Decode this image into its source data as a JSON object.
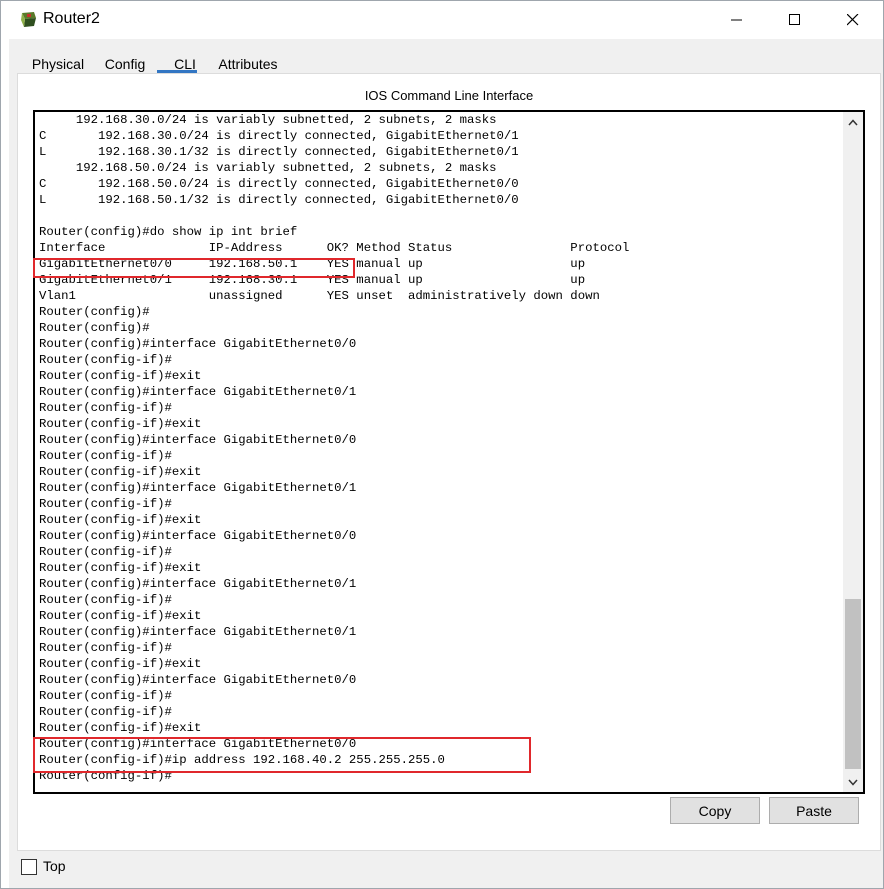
{
  "window": {
    "title": "Router2"
  },
  "tabs": [
    {
      "label": "Physical"
    },
    {
      "label": "Config"
    },
    {
      "label": "CLI"
    },
    {
      "label": "Attributes"
    }
  ],
  "active_tab": "CLI",
  "panel": {
    "title": "IOS Command Line Interface"
  },
  "console": {
    "lines": [
      "     192.168.30.0/24 is variably subnetted, 2 subnets, 2 masks",
      "C       192.168.30.0/24 is directly connected, GigabitEthernet0/1",
      "L       192.168.30.1/32 is directly connected, GigabitEthernet0/1",
      "     192.168.50.0/24 is variably subnetted, 2 subnets, 2 masks",
      "C       192.168.50.0/24 is directly connected, GigabitEthernet0/0",
      "L       192.168.50.1/32 is directly connected, GigabitEthernet0/0",
      "",
      "Router(config)#do show ip int brief",
      "Interface              IP-Address      OK? Method Status                Protocol",
      "GigabitEthernet0/0     192.168.50.1    YES manual up                    up",
      "GigabitEthernet0/1     192.168.30.1    YES manual up                    up",
      "Vlan1                  unassigned      YES unset  administratively down down",
      "Router(config)#",
      "Router(config)#",
      "Router(config)#interface GigabitEthernet0/0",
      "Router(config-if)#",
      "Router(config-if)#exit",
      "Router(config)#interface GigabitEthernet0/1",
      "Router(config-if)#",
      "Router(config-if)#exit",
      "Router(config)#interface GigabitEthernet0/0",
      "Router(config-if)#",
      "Router(config-if)#exit",
      "Router(config)#interface GigabitEthernet0/1",
      "Router(config-if)#",
      "Router(config-if)#exit",
      "Router(config)#interface GigabitEthernet0/0",
      "Router(config-if)#",
      "Router(config-if)#exit",
      "Router(config)#interface GigabitEthernet0/1",
      "Router(config-if)#",
      "Router(config-if)#exit",
      "Router(config)#interface GigabitEthernet0/1",
      "Router(config-if)#",
      "Router(config-if)#exit",
      "Router(config)#interface GigabitEthernet0/0",
      "Router(config-if)#",
      "Router(config-if)#",
      "Router(config-if)#exit",
      "Router(config)#interface GigabitEthernet0/0",
      "Router(config-if)#ip address 192.168.40.2 255.255.255.0",
      "Router(config-if)#"
    ]
  },
  "buttons": {
    "copy": "Copy",
    "paste": "Paste"
  },
  "top_checkbox": {
    "label": "Top",
    "checked": false
  },
  "colors": {
    "accent": "#3276c3",
    "highlight": "#e0282c"
  }
}
